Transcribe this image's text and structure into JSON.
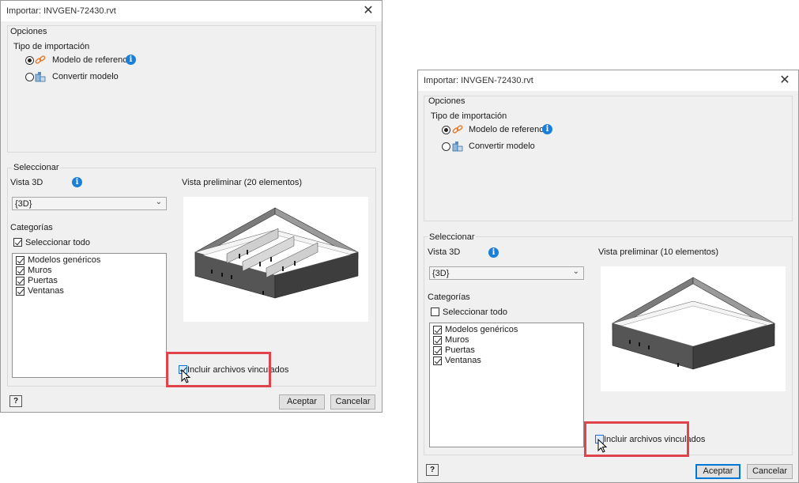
{
  "left_dialog": {
    "title": "Importar: INVGEN-72430.rvt",
    "close_glyph": "✕",
    "options_label": "Opciones",
    "import_type_label": "Tipo de importación",
    "option_reference": "Modelo de referencia",
    "option_convert": "Convertir modelo",
    "selected_option": "Modelo de referencia",
    "select_label": "Seleccionar",
    "view3d_label": "Vista 3D",
    "view3d_value": "{3D}",
    "preview_label": "Vista preliminar (20 elementos)",
    "categories_label": "Categorías",
    "select_all_label": "Seleccionar todo",
    "select_all_checked": true,
    "categories": [
      {
        "label": "Modelos genéricos",
        "checked": true
      },
      {
        "label": "Muros",
        "checked": true
      },
      {
        "label": "Puertas",
        "checked": true
      },
      {
        "label": "Ventanas",
        "checked": true
      }
    ],
    "include_linked_label": "Incluir archivos vinculados",
    "include_linked_checked": true,
    "help_glyph": "?",
    "accept_label": "Aceptar",
    "cancel_label": "Cancelar"
  },
  "right_dialog": {
    "title": "Importar: INVGEN-72430.rvt",
    "close_glyph": "✕",
    "options_label": "Opciones",
    "import_type_label": "Tipo de importación",
    "option_reference": "Modelo de referencia",
    "option_convert": "Convertir modelo",
    "selected_option": "Modelo de referencia",
    "select_label": "Seleccionar",
    "view3d_label": "Vista 3D",
    "view3d_value": "{3D}",
    "preview_label": "Vista preliminar (10 elementos)",
    "categories_label": "Categorías",
    "select_all_label": "Seleccionar todo",
    "select_all_checked": false,
    "categories": [
      {
        "label": "Modelos genéricos",
        "checked": true
      },
      {
        "label": "Muros",
        "checked": true
      },
      {
        "label": "Puertas",
        "checked": true
      },
      {
        "label": "Ventanas",
        "checked": true
      }
    ],
    "include_linked_label": "Incluir archivos vinculados",
    "include_linked_checked": false,
    "help_glyph": "?",
    "accept_label": "Aceptar",
    "cancel_label": "Cancelar"
  },
  "icons": {
    "reference": "link-chain-icon",
    "convert": "convert-model-icon",
    "info": "info-icon",
    "help": "help-icon",
    "cursor": "mouse-pointer-icon"
  },
  "colors": {
    "highlight_border": "#e0434b",
    "info_blue": "#1a7fd8",
    "link_orange": "#e07a2a",
    "default_button_border": "#0078d7"
  }
}
